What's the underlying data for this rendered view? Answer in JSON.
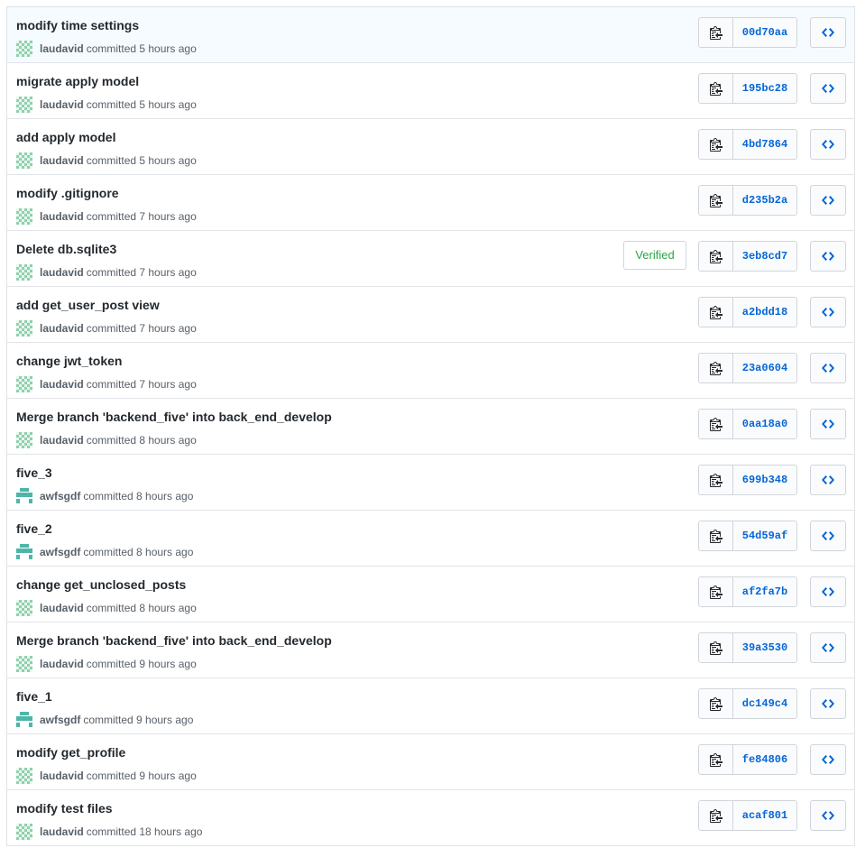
{
  "commits": [
    {
      "title": "modify time settings",
      "author": "laudavid",
      "time": "committed 5 hours ago",
      "sha": "00d70aa",
      "avatar": "identicon-checker-green",
      "verified": ""
    },
    {
      "title": "migrate apply model",
      "author": "laudavid",
      "time": "committed 5 hours ago",
      "sha": "195bc28",
      "avatar": "identicon-checker-green",
      "verified": ""
    },
    {
      "title": "add apply model",
      "author": "laudavid",
      "time": "committed 5 hours ago",
      "sha": "4bd7864",
      "avatar": "identicon-checker-green",
      "verified": ""
    },
    {
      "title": "modify .gitignore",
      "author": "laudavid",
      "time": "committed 7 hours ago",
      "sha": "d235b2a",
      "avatar": "identicon-checker-green",
      "verified": ""
    },
    {
      "title": "Delete db.sqlite3",
      "author": "laudavid",
      "time": "committed 7 hours ago",
      "sha": "3eb8cd7",
      "avatar": "identicon-checker-green",
      "verified": "Verified"
    },
    {
      "title": "add get_user_post view",
      "author": "laudavid",
      "time": "committed 7 hours ago",
      "sha": "a2bdd18",
      "avatar": "identicon-checker-green",
      "verified": ""
    },
    {
      "title": "change jwt_token",
      "author": "laudavid",
      "time": "committed 7 hours ago",
      "sha": "23a0604",
      "avatar": "identicon-checker-green",
      "verified": ""
    },
    {
      "title": "Merge branch 'backend_five' into back_end_develop",
      "author": "laudavid",
      "time": "committed 8 hours ago",
      "sha": "0aa18a0",
      "avatar": "identicon-checker-green",
      "verified": ""
    },
    {
      "title": "five_3",
      "author": "awfsgdf",
      "time": "committed 8 hours ago",
      "sha": "699b348",
      "avatar": "identicon-invader-teal",
      "verified": ""
    },
    {
      "title": "five_2",
      "author": "awfsgdf",
      "time": "committed 8 hours ago",
      "sha": "54d59af",
      "avatar": "identicon-invader-teal",
      "verified": ""
    },
    {
      "title": "change get_unclosed_posts",
      "author": "laudavid",
      "time": "committed 8 hours ago",
      "sha": "af2fa7b",
      "avatar": "identicon-checker-green",
      "verified": ""
    },
    {
      "title": "Merge branch 'backend_five' into back_end_develop",
      "author": "laudavid",
      "time": "committed 9 hours ago",
      "sha": "39a3530",
      "avatar": "identicon-checker-green",
      "verified": ""
    },
    {
      "title": "five_1",
      "author": "awfsgdf",
      "time": "committed 9 hours ago",
      "sha": "dc149c4",
      "avatar": "identicon-invader-teal",
      "verified": ""
    },
    {
      "title": "modify get_profile",
      "author": "laudavid",
      "time": "committed 9 hours ago",
      "sha": "fe84806",
      "avatar": "identicon-checker-green",
      "verified": ""
    },
    {
      "title": "modify test files",
      "author": "laudavid",
      "time": "committed 18 hours ago",
      "sha": "acaf801",
      "avatar": "identicon-checker-green",
      "verified": ""
    }
  ],
  "icons": {
    "copy": "clippy-icon",
    "browse": "code-icon"
  },
  "colors": {
    "sha": "#0366d6",
    "verified": "#28a745",
    "highlight_row": "#f6fbff"
  }
}
